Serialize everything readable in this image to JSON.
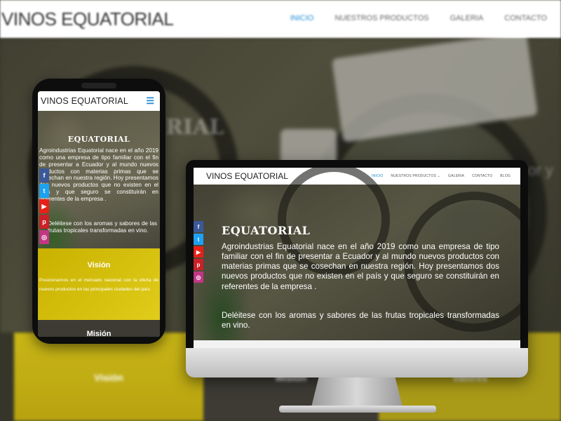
{
  "background_site": {
    "brand": "VINOS EQUATORIAL",
    "nav": [
      "INICIO",
      "NUESTROS PRODUCTOS",
      "GALERIA",
      "CONTACTO"
    ],
    "hero_fragment_1": "RIAL",
    "hero_fragment_2": "Ecuador y al",
    "columns": [
      "Visión",
      "Misión",
      "Valores"
    ]
  },
  "phone": {
    "brand": "VINOS EQUATORIAL",
    "menu_icon": "☰",
    "hero_title": "EQUATORIAL",
    "hero_text": "Agroindustrias Equatorial nace en el año 2019 como una empresa de tipo familiar con el fin de presentar a Ecuador y al mundo nuevos productos con materias primas que se cosechan en nuestra región. Hoy presentamos dos nuevos productos que no existen en el país y que seguro se constituirán en referentes de la empresa .",
    "hero_text_2": "Deléitese con los aromas y sabores de las frutas tropicales transformadas en vino.",
    "vision_title": "Visión",
    "vision_text": "Posicionarnos en el mercado nacional con la oferta de nuevos productos en las principales ciudades del país",
    "mision_title": "Misión"
  },
  "desktop": {
    "brand": "VINOS EQUATORIAL",
    "nav": [
      "INICIO",
      "NUESTROS PRODUCTOS ⌄",
      "GALERIA",
      "CONTACTO",
      "BLOG"
    ],
    "hero_title": "EQUATORIAL",
    "hero_text": "Agroindustrias Equatorial nace en el año 2019 como una empresa de tipo familiar con el fin de presentar a Ecuador y al mundo nuevos productos con materias primas que se cosechan en nuestra región. Hoy presentamos dos nuevos productos que no existen en el país y que seguro se constituirán en referentes de la empresa .",
    "hero_text_2": "Deléitese con los aromas y sabores de las frutas tropicales transformadas en vino."
  },
  "social": [
    {
      "name": "facebook-icon",
      "glyph": "f",
      "color": "#3b5998"
    },
    {
      "name": "twitter-icon",
      "glyph": "t",
      "color": "#1da1f2"
    },
    {
      "name": "youtube-icon",
      "glyph": "▶",
      "color": "#e62117"
    },
    {
      "name": "pinterest-icon",
      "glyph": "p",
      "color": "#cb2027"
    },
    {
      "name": "instagram-icon",
      "glyph": "◎",
      "color": "#c13584"
    }
  ],
  "colors": {
    "accent": "#1f8bd6",
    "vision_yellow": "#c9b100",
    "dark_panel": "#3d3b34"
  }
}
